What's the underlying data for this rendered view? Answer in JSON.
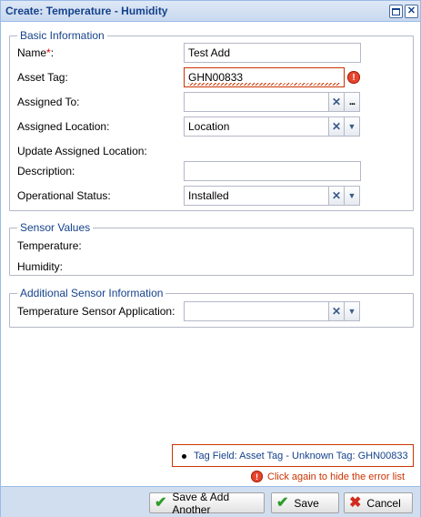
{
  "window": {
    "title": "Create: Temperature - Humidity",
    "maximize_icon": "maximize-icon",
    "close_icon": "close-icon"
  },
  "basic_information": {
    "legend": "Basic Information",
    "name": {
      "label": "Name",
      "required_marker": "*",
      "colon": ":",
      "value": "Test Add"
    },
    "asset_tag": {
      "label": "Asset Tag:",
      "value": "GHN00833",
      "invalid": true
    },
    "assigned_to": {
      "label": "Assigned To:",
      "value": ""
    },
    "assigned_location": {
      "label": "Assigned Location:",
      "value": "Location"
    },
    "update_assigned_location": {
      "label": "Update Assigned Location:"
    },
    "description": {
      "label": "Description:",
      "value": ""
    },
    "operational_status": {
      "label": "Operational Status:",
      "value": "Installed"
    }
  },
  "sensor_values": {
    "legend": "Sensor Values",
    "temperature_label": "Temperature:",
    "humidity_label": "Humidity:"
  },
  "additional_sensor_information": {
    "legend": "Additional Sensor Information",
    "temperature_sensor_application": {
      "label": "Temperature Sensor Application:",
      "value": ""
    }
  },
  "errors": {
    "items": [
      "Tag Field: Asset Tag - Unknown Tag: GHN00833"
    ],
    "hide_hint": "Click again to hide the error list"
  },
  "footer": {
    "save_add_another": "Save & Add Another",
    "save": "Save",
    "cancel": "Cancel"
  },
  "colors": {
    "title": "#15428b",
    "error": "#cc3300",
    "accent": "#99bbe8"
  }
}
